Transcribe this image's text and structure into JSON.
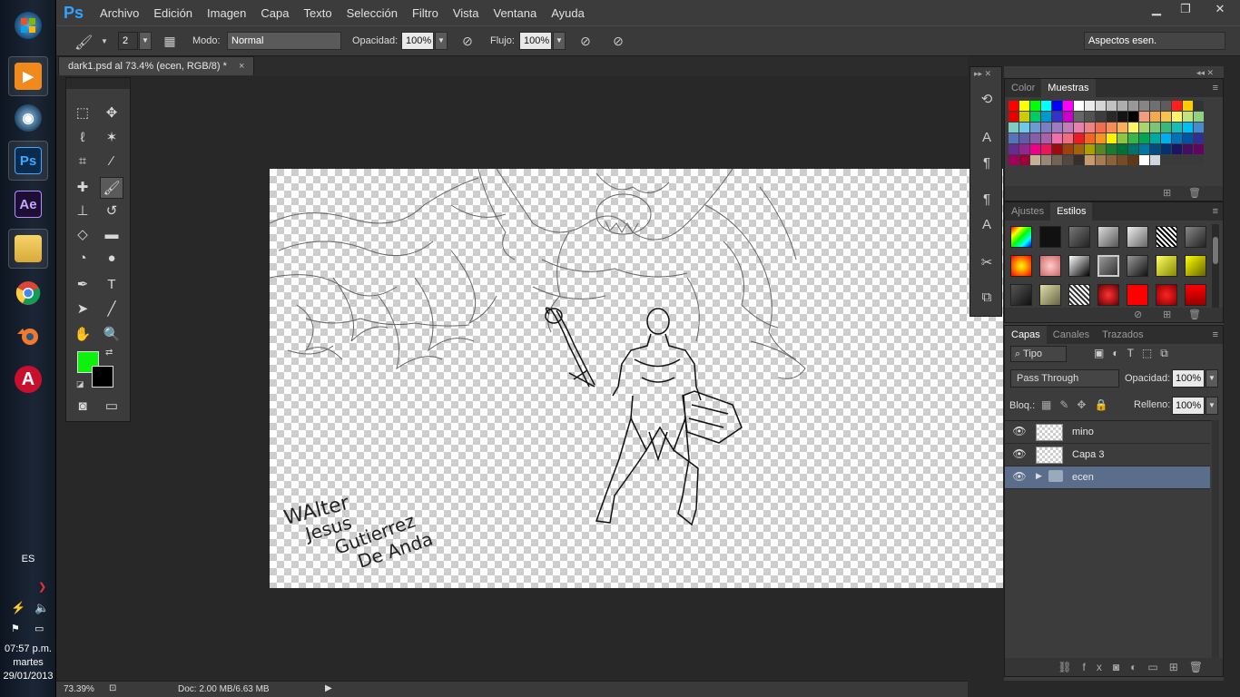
{
  "taskbar": {
    "apps": [
      {
        "name": "windows-start",
        "label": ""
      },
      {
        "name": "media-player",
        "label": ""
      },
      {
        "name": "media-center",
        "label": ""
      },
      {
        "name": "photoshop",
        "label": "Ps"
      },
      {
        "name": "after-effects",
        "label": "Ae"
      },
      {
        "name": "file-explorer",
        "label": ""
      },
      {
        "name": "chrome",
        "label": ""
      },
      {
        "name": "blender",
        "label": ""
      },
      {
        "name": "autocad",
        "label": "A"
      }
    ],
    "language": "ES",
    "time": "07:57 p.m.",
    "day": "martes",
    "date": "29/01/2013"
  },
  "app": {
    "logo": "Ps",
    "menu": [
      "Archivo",
      "Edición",
      "Imagen",
      "Capa",
      "Texto",
      "Selección",
      "Filtro",
      "Vista",
      "Ventana",
      "Ayuda"
    ]
  },
  "options": {
    "brush_size": "2",
    "mode_label": "Modo:",
    "mode_value": "Normal",
    "opacity_label": "Opacidad:",
    "opacity_value": "100%",
    "flow_label": "Flujo:",
    "flow_value": "100%",
    "workspace": "Aspectos esen."
  },
  "document": {
    "tab_title": "dark1.psd al 73.4% (ecen, RGB/8) *",
    "signature": [
      "WAlter",
      "Jesus",
      "Gutierrez",
      "De Anda"
    ]
  },
  "status": {
    "zoom": "73.39%",
    "doc_size": "Doc: 2.00 MB/6.63 MB"
  },
  "swatches_panel": {
    "tabs": [
      "Color",
      "Muestras"
    ]
  },
  "styles_panel": {
    "tabs": [
      "Ajustes",
      "Estilos"
    ]
  },
  "layers_panel": {
    "tabs": [
      "Capas",
      "Canales",
      "Trazados"
    ],
    "filter_label": "Tipo",
    "blend_mode": "Pass Through",
    "opacity_label": "Opacidad:",
    "opacity_value": "100%",
    "lock_label": "Bloq.:",
    "fill_label": "Relleno:",
    "fill_value": "100%",
    "layers": [
      {
        "name": "mino",
        "selected": false
      },
      {
        "name": "Capa 3",
        "selected": false
      },
      {
        "name": "ecen",
        "selected": true
      }
    ]
  },
  "colors": {
    "foreground": "#0ef00e",
    "background": "#000000",
    "accent": "#2fa3ff",
    "selection": "#5a6e8c"
  }
}
